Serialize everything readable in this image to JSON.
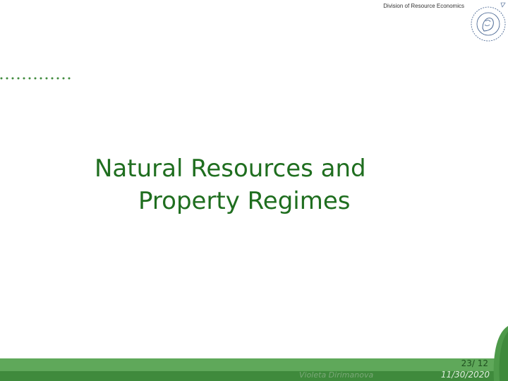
{
  "header": {
    "division": "Division of Resource Economics",
    "seal_icon": "university-seal-icon"
  },
  "slide": {
    "title_line1": "Natural Resources and",
    "title_line2": "Property Regimes"
  },
  "footer": {
    "presenter": "Violeta Dirimanova",
    "page": "23/ 12",
    "date": "11/30/2020"
  },
  "colors": {
    "title": "#1f6e1f",
    "footer_light": "#5fa85a",
    "footer_dark": "#3f8a3c",
    "dots": "#3f8a3c"
  }
}
